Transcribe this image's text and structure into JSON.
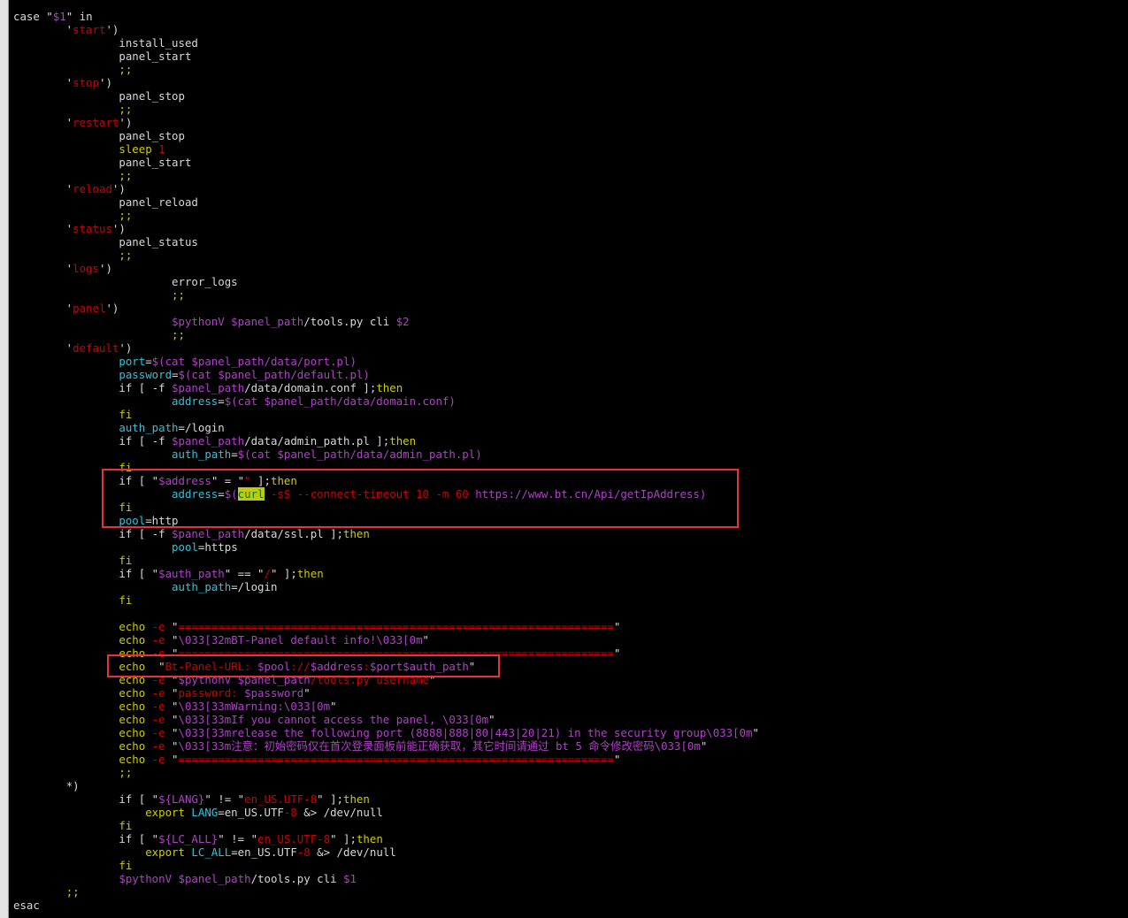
{
  "colors": {
    "background": "#000000",
    "keyword": "#cdcd00",
    "string": "#cd0000",
    "variable": "#b040c8",
    "assignment": "#2fc3d9",
    "text": "#d8d8d8",
    "annotation_box": "#e8323a"
  },
  "lines": [
    [
      [
        "c-plain",
        "case \""
      ],
      [
        "c-var",
        "$1"
      ],
      [
        "c-plain",
        "\" in"
      ]
    ],
    [
      [
        "c-plain",
        "        '"
      ],
      [
        "c-string",
        "start"
      ],
      [
        "c-plain",
        "')"
      ]
    ],
    [
      [
        "c-plain",
        "                install_used"
      ]
    ],
    [
      [
        "c-plain",
        "                panel_start"
      ]
    ],
    [
      [
        "c-plain",
        "                "
      ],
      [
        "c-sep",
        ";;"
      ]
    ],
    [
      [
        "c-plain",
        "        '"
      ],
      [
        "c-string",
        "stop"
      ],
      [
        "c-plain",
        "')"
      ]
    ],
    [
      [
        "c-plain",
        "                panel_stop"
      ]
    ],
    [
      [
        "c-plain",
        "                "
      ],
      [
        "c-sep",
        ";;"
      ]
    ],
    [
      [
        "c-plain",
        "        '"
      ],
      [
        "c-string",
        "restart"
      ],
      [
        "c-plain",
        "')"
      ]
    ],
    [
      [
        "c-plain",
        "                panel_stop"
      ]
    ],
    [
      [
        "c-plain",
        "                "
      ],
      [
        "c-keyword",
        "sleep "
      ],
      [
        "c-number",
        "1"
      ]
    ],
    [
      [
        "c-plain",
        "                panel_start"
      ]
    ],
    [
      [
        "c-plain",
        "                "
      ],
      [
        "c-sep",
        ";;"
      ]
    ],
    [
      [
        "c-plain",
        "        '"
      ],
      [
        "c-string",
        "reload"
      ],
      [
        "c-plain",
        "')"
      ]
    ],
    [
      [
        "c-plain",
        "                panel_reload"
      ]
    ],
    [
      [
        "c-plain",
        "                "
      ],
      [
        "c-sep",
        ";;"
      ]
    ],
    [
      [
        "c-plain",
        "        '"
      ],
      [
        "c-string",
        "status"
      ],
      [
        "c-plain",
        "')"
      ]
    ],
    [
      [
        "c-plain",
        "                panel_status"
      ]
    ],
    [
      [
        "c-plain",
        "                "
      ],
      [
        "c-sep",
        ";;"
      ]
    ],
    [
      [
        "c-plain",
        "        '"
      ],
      [
        "c-string",
        "logs"
      ],
      [
        "c-plain",
        "')"
      ]
    ],
    [
      [
        "c-plain",
        "                        error_logs"
      ]
    ],
    [
      [
        "c-plain",
        "                        "
      ],
      [
        "c-sep",
        ";;"
      ]
    ],
    [
      [
        "c-plain",
        "        '"
      ],
      [
        "c-string",
        "panel"
      ],
      [
        "c-plain",
        "')"
      ]
    ],
    [
      [
        "c-plain",
        "                        "
      ],
      [
        "c-var",
        "$pythonV $panel_path"
      ],
      [
        "c-plain",
        "/tools.py cli "
      ],
      [
        "c-var",
        "$2"
      ]
    ],
    [
      [
        "c-plain",
        "                        "
      ],
      [
        "c-sep",
        ";;"
      ]
    ],
    [
      [
        "c-plain",
        "        '"
      ],
      [
        "c-string",
        "default"
      ],
      [
        "c-plain",
        "')"
      ]
    ],
    [
      [
        "c-plain",
        "                "
      ],
      [
        "c-assign",
        "port"
      ],
      [
        "c-plain",
        "="
      ],
      [
        "c-var",
        "$(cat $panel_path/data/port.pl)"
      ]
    ],
    [
      [
        "c-plain",
        "                "
      ],
      [
        "c-assign",
        "password"
      ],
      [
        "c-plain",
        "="
      ],
      [
        "c-var",
        "$(cat $panel_path/default.pl)"
      ]
    ],
    [
      [
        "c-plain",
        "                if [ -f "
      ],
      [
        "c-var",
        "$panel_path"
      ],
      [
        "c-plain",
        "/data/domain.conf ];"
      ],
      [
        "c-keyword",
        "then"
      ]
    ],
    [
      [
        "c-plain",
        "                        "
      ],
      [
        "c-assign",
        "address"
      ],
      [
        "c-plain",
        "="
      ],
      [
        "c-var",
        "$(cat $panel_path/data/domain.conf)"
      ]
    ],
    [
      [
        "c-keyword",
        "                fi"
      ]
    ],
    [
      [
        "c-plain",
        "                "
      ],
      [
        "c-assign",
        "auth_path"
      ],
      [
        "c-plain",
        "=/login"
      ]
    ],
    [
      [
        "c-plain",
        "                if [ -f "
      ],
      [
        "c-var",
        "$panel_path"
      ],
      [
        "c-plain",
        "/data/admin_path.pl ];"
      ],
      [
        "c-keyword",
        "then"
      ]
    ],
    [
      [
        "c-plain",
        "                        "
      ],
      [
        "c-assign",
        "auth_path"
      ],
      [
        "c-plain",
        "="
      ],
      [
        "c-var",
        "$(cat $panel_path/data/admin_path.pl)"
      ]
    ],
    [
      [
        "c-keyword",
        "                fi"
      ]
    ],
    [
      [
        "c-plain",
        "                if [ \""
      ],
      [
        "c-var",
        "$address"
      ],
      [
        "c-plain",
        "\" = \""
      ],
      [
        "c-string",
        "\""
      ],
      [
        "c-plain",
        " ];"
      ],
      [
        "c-keyword",
        "then"
      ]
    ],
    [
      [
        "c-plain",
        "                        "
      ],
      [
        "c-assign",
        "address"
      ],
      [
        "c-plain",
        "="
      ],
      [
        "c-var",
        "$("
      ],
      [
        "c-hl",
        "curl"
      ],
      [
        "c-string",
        " -sS --connect-timeout 10 -m 60 "
      ],
      [
        "c-var",
        "https://www.bt.cn/Api/getIpAddress)"
      ]
    ],
    [
      [
        "c-keyword",
        "                fi"
      ]
    ],
    [
      [
        "c-plain",
        "                "
      ],
      [
        "c-assign",
        "pool"
      ],
      [
        "c-plain",
        "=http"
      ]
    ],
    [
      [
        "c-plain",
        "                if [ -f "
      ],
      [
        "c-var",
        "$panel_path"
      ],
      [
        "c-plain",
        "/data/ssl.pl ];"
      ],
      [
        "c-keyword",
        "then"
      ]
    ],
    [
      [
        "c-plain",
        "                        "
      ],
      [
        "c-assign",
        "pool"
      ],
      [
        "c-plain",
        "=https"
      ]
    ],
    [
      [
        "c-keyword",
        "                fi"
      ]
    ],
    [
      [
        "c-plain",
        "                if [ \""
      ],
      [
        "c-var",
        "$auth_path"
      ],
      [
        "c-plain",
        "\" == \""
      ],
      [
        "c-string",
        "/"
      ],
      [
        "c-plain",
        "\" ];"
      ],
      [
        "c-keyword",
        "then"
      ]
    ],
    [
      [
        "c-plain",
        "                        "
      ],
      [
        "c-assign",
        "auth_path"
      ],
      [
        "c-plain",
        "=/login"
      ]
    ],
    [
      [
        "c-keyword",
        "                fi"
      ]
    ],
    [
      [
        "c-plain",
        ""
      ]
    ],
    [
      [
        "c-keyword",
        "                echo"
      ],
      [
        "c-string",
        " -e "
      ],
      [
        "c-plain",
        "\""
      ],
      [
        "c-string",
        "=================================================================="
      ],
      [
        "c-plain",
        "\""
      ]
    ],
    [
      [
        "c-keyword",
        "                echo"
      ],
      [
        "c-string",
        " -e "
      ],
      [
        "c-plain",
        "\""
      ],
      [
        "c-var",
        "\\033[32mBT-Panel default info!\\033[0m"
      ],
      [
        "c-plain",
        "\""
      ]
    ],
    [
      [
        "c-keyword",
        "                echo"
      ],
      [
        "c-string",
        " -e "
      ],
      [
        "c-plain",
        "\""
      ],
      [
        "c-string",
        "=================================================================="
      ],
      [
        "c-plain",
        "\""
      ]
    ],
    [
      [
        "c-keyword",
        "                echo"
      ],
      [
        "c-plain",
        "  \""
      ],
      [
        "c-string",
        "Bt-Panel-URL: "
      ],
      [
        "c-var",
        "$pool"
      ],
      [
        "c-string",
        "://"
      ],
      [
        "c-var",
        "$address"
      ],
      [
        "c-string",
        ":"
      ],
      [
        "c-var",
        "$port$auth_path"
      ],
      [
        "c-plain",
        "\""
      ]
    ],
    [
      [
        "c-keyword",
        "                echo"
      ],
      [
        "c-string",
        " -e "
      ],
      [
        "c-plain",
        "\""
      ],
      [
        "c-var",
        "$pythonV $panel_path"
      ],
      [
        "c-string",
        "/tools.py username"
      ],
      [
        "c-plain",
        "\""
      ]
    ],
    [
      [
        "c-keyword",
        "                echo"
      ],
      [
        "c-string",
        " -e "
      ],
      [
        "c-plain",
        "\""
      ],
      [
        "c-string",
        "password: "
      ],
      [
        "c-var",
        "$password"
      ],
      [
        "c-plain",
        "\""
      ]
    ],
    [
      [
        "c-keyword",
        "                echo"
      ],
      [
        "c-string",
        " -e "
      ],
      [
        "c-plain",
        "\""
      ],
      [
        "c-var",
        "\\033[33mWarning:\\033[0m"
      ],
      [
        "c-plain",
        "\""
      ]
    ],
    [
      [
        "c-keyword",
        "                echo"
      ],
      [
        "c-string",
        " -e "
      ],
      [
        "c-plain",
        "\""
      ],
      [
        "c-var",
        "\\033[33mIf you cannot access the panel, \\033[0m"
      ],
      [
        "c-plain",
        "\""
      ]
    ],
    [
      [
        "c-keyword",
        "                echo"
      ],
      [
        "c-string",
        " -e "
      ],
      [
        "c-plain",
        "\""
      ],
      [
        "c-var",
        "\\033[33mrelease the following port (8888|888|80|443|20|21) in the security group\\033[0m"
      ],
      [
        "c-plain",
        "\""
      ]
    ],
    [
      [
        "c-keyword",
        "                echo"
      ],
      [
        "c-string",
        " -e "
      ],
      [
        "c-plain",
        "\""
      ],
      [
        "c-var",
        "\\033[33m注意：初始密码仅在首次登录面板前能正确获取，其它时间请通过 bt 5 命令修改密码\\033[0m"
      ],
      [
        "c-plain",
        "\""
      ]
    ],
    [
      [
        "c-keyword",
        "                echo"
      ],
      [
        "c-string",
        " -e "
      ],
      [
        "c-plain",
        "\""
      ],
      [
        "c-string",
        "=================================================================="
      ],
      [
        "c-plain",
        "\""
      ]
    ],
    [
      [
        "c-plain",
        "                "
      ],
      [
        "c-sep",
        ";;"
      ]
    ],
    [
      [
        "c-plain",
        "        *)"
      ]
    ],
    [
      [
        "c-plain",
        "                if [ \""
      ],
      [
        "c-var",
        "${LANG}"
      ],
      [
        "c-plain",
        "\" != \""
      ],
      [
        "c-string",
        "en_US.UTF-8"
      ],
      [
        "c-plain",
        "\" ];"
      ],
      [
        "c-keyword",
        "then"
      ]
    ],
    [
      [
        "c-keyword",
        "                    export "
      ],
      [
        "c-assign",
        "LANG"
      ],
      [
        "c-plain",
        "=en_US.UTF"
      ],
      [
        "c-string",
        "-8"
      ],
      [
        "c-plain",
        " &> /dev/null"
      ]
    ],
    [
      [
        "c-keyword",
        "                fi"
      ]
    ],
    [
      [
        "c-plain",
        "                if [ \""
      ],
      [
        "c-var",
        "${LC_ALL}"
      ],
      [
        "c-plain",
        "\" != \""
      ],
      [
        "c-string",
        "en_US.UTF-8"
      ],
      [
        "c-plain",
        "\" ];"
      ],
      [
        "c-keyword",
        "then"
      ]
    ],
    [
      [
        "c-keyword",
        "                    export "
      ],
      [
        "c-assign",
        "LC_ALL"
      ],
      [
        "c-plain",
        "=en_US.UTF"
      ],
      [
        "c-string",
        "-8"
      ],
      [
        "c-plain",
        " &> /dev/null"
      ]
    ],
    [
      [
        "c-keyword",
        "                fi"
      ]
    ],
    [
      [
        "c-plain",
        "                "
      ],
      [
        "c-var",
        "$pythonV $panel_path"
      ],
      [
        "c-plain",
        "/tools.py cli "
      ],
      [
        "c-var",
        "$1"
      ]
    ],
    [
      [
        "c-plain",
        "        "
      ],
      [
        "c-sep",
        ";;"
      ]
    ],
    [
      [
        "c-plain",
        "esac"
      ]
    ]
  ]
}
